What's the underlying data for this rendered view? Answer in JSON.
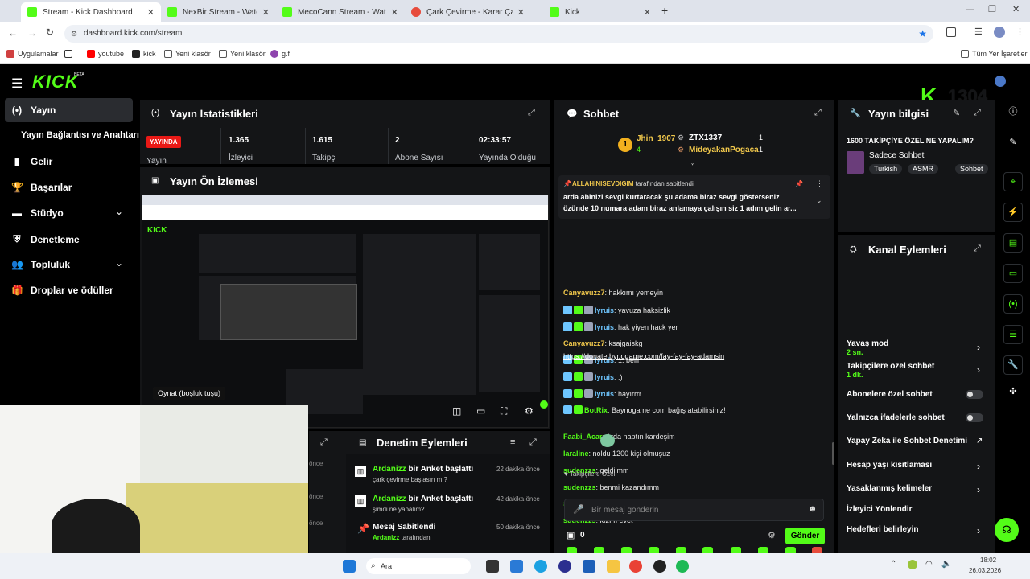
{
  "browser": {
    "tabs": [
      {
        "title": "Stream - Kick Dashboard",
        "active": true,
        "color": "#53fc18"
      },
      {
        "title": "NexBir Stream - Watch Live on",
        "active": false,
        "color": "#53fc18"
      },
      {
        "title": "MecoCann Stream - Watch Live",
        "active": false,
        "color": "#53fc18"
      },
      {
        "title": "Çark Çevirme - Karar Çarkı",
        "active": false,
        "color": "#e74c3c"
      },
      {
        "title": "Kick",
        "active": false,
        "color": "#53fc18"
      }
    ],
    "url": "dashboard.kick.com/stream",
    "bookmarks": [
      {
        "label": "Uygulamalar"
      },
      {
        "label": "youtube"
      },
      {
        "label": "kick"
      },
      {
        "label": "Yeni klasör"
      },
      {
        "label": "Yeni klasör"
      },
      {
        "label": "g.f"
      }
    ],
    "all_bookmarks": "Tüm Yer İşaretleri"
  },
  "kick": {
    "logo": "KICK",
    "logo_tag": "BETA",
    "overlay_count": "1304"
  },
  "sidebar": {
    "items": [
      {
        "label": "Yayın",
        "icon": "broadcast-icon",
        "active": true
      },
      {
        "label": "Yayın Bağlantısı ve Anahtarı",
        "icon": "",
        "active": false
      },
      {
        "label": "Gelir",
        "icon": "chart-icon",
        "active": false
      },
      {
        "label": "Başarılar",
        "icon": "trophy-icon",
        "active": false
      },
      {
        "label": "Stüdyo",
        "icon": "studio-icon",
        "active": false,
        "chevron": true
      },
      {
        "label": "Denetleme",
        "icon": "shield-icon",
        "active": false
      },
      {
        "label": "Topluluk",
        "icon": "users-icon",
        "active": false,
        "chevron": true
      },
      {
        "label": "Droplar ve ödüller",
        "icon": "gift-icon",
        "active": false
      }
    ]
  },
  "stats": {
    "title": "Yayın İstatistikleri",
    "live_badge": "YAYINDA",
    "live_label": "Yayın",
    "items": [
      {
        "value": "1.365",
        "label": "İzleyici"
      },
      {
        "value": "1.615",
        "label": "Takipçi"
      },
      {
        "value": "2",
        "label": "Abone Sayısı"
      },
      {
        "value": "02:33:57",
        "label": "Yayında Olduğu"
      }
    ]
  },
  "preview": {
    "title": "Yayın Ön İzlemesi",
    "tooltip": "Oynat (boşluk tuşu)"
  },
  "modlog": {
    "title": "Denetim Eylemleri",
    "left_times": [
      "önce",
      "önce",
      "önce"
    ],
    "entries": [
      {
        "user": "Ardanizz",
        "action": " bir Anket başlattı",
        "detail": "çark çevirme başlasın mı?",
        "time": "22 dakika önce"
      },
      {
        "user": "Ardanizz",
        "action": " bir Anket başlattı",
        "detail": "şimdi ne yapalım?",
        "time": "42 dakika önce"
      },
      {
        "user": "Mesaj Sabitlendi",
        "action": "",
        "detail_user": "Ardanizz",
        "detail": " tarafından",
        "time": "50 dakika önce"
      }
    ]
  },
  "chat": {
    "title": "Sohbet",
    "top_gifters": [
      {
        "rank": "1",
        "name": "Jhin_1907",
        "count": "4"
      },
      {
        "rank": "",
        "name": "ZTX1337",
        "count": "1"
      },
      {
        "rank": "",
        "name": "MideyakanPogaca",
        "count": "1"
      }
    ],
    "pinned_by": "ALLAHINISEVDIGIM",
    "pinned_suffix": " tarafından sabitlendi",
    "pinned_text_1": "arda abinizi sevgi kurtaracak şu adama biraz sevgi gösterseniz",
    "pinned_text_2": "özünde 10 numara adam biraz anlamaya çalışın siz 1 adım gelin ar...",
    "messages": [
      {
        "user": "Canyavuzz7",
        "color": "y",
        "badges": 0,
        "text": ": hakkımı yemeyin"
      },
      {
        "user": "lyruis",
        "color": "b",
        "badges": 3,
        "text": ": yavuza haksizlik"
      },
      {
        "user": "lyruis",
        "color": "b",
        "badges": 3,
        "text": ": hak yiyen hack yer"
      },
      {
        "user": "Canyavuzz7",
        "color": "y",
        "badges": 0,
        "text": ": ksajgaiskg"
      },
      {
        "user": "lyruis",
        "color": "b",
        "badges": 3,
        "text": ": 1. belli"
      },
      {
        "user": "lyruis",
        "color": "b",
        "badges": 3,
        "text": ": :)"
      },
      {
        "user": "lyruis",
        "color": "b",
        "badges": 3,
        "text": ": hayırrrr"
      },
      {
        "user": "BotRix",
        "color": "g",
        "badges": 2,
        "text": ": Baynogame com bağış atabilirsiniz!"
      },
      {
        "user": "Faabi_Acar",
        "color": "g",
        "badges": 0,
        "text": ": Arda naptın kardeşim"
      },
      {
        "user": "laraline",
        "color": "g",
        "badges": 0,
        "text": ": noldu 1200 kişi olmuşuz"
      },
      {
        "user": "sudenzzs",
        "color": "g",
        "badges": 0,
        "text": ": geldiimm"
      },
      {
        "user": "sudenzzs",
        "color": "g",
        "badges": 0,
        "text": ": benmi kazandımm"
      },
      {
        "user": "sudenzzs",
        "color": "g",
        "badges": 0,
        "text": ":"
      },
      {
        "user": "sudenzzs",
        "color": "g",
        "badges": 0,
        "text": ": kızım evet"
      }
    ],
    "donate_link": "https://donate.bynogame.com/fay-fay-fay-adamsin",
    "followers_only": "Takipçilere Özel",
    "input_placeholder": "Bir mesaj gönderin",
    "points": "0",
    "send_label": "Gönder"
  },
  "stream_info": {
    "title": "Yayın bilgisi",
    "stream_title": "1600 TAKİPÇİYE ÖZEL NE YAPALIM?",
    "category": "Sadece Sohbet",
    "tags": [
      "Turkish",
      "ASMR",
      "Sohbet"
    ]
  },
  "channel_actions": {
    "title": "Kanal Eylemleri",
    "items": [
      {
        "label": "Yavaş mod",
        "sub": "2 sn.",
        "type": "chevron"
      },
      {
        "label": "Takipçilere özel sohbet",
        "sub": "1 dk.",
        "type": "chevron"
      },
      {
        "label": "Abonelere özel sohbet",
        "sub": "",
        "type": "toggle"
      },
      {
        "label": "Yalnızca ifadelerle sohbet",
        "sub": "",
        "type": "toggle"
      },
      {
        "label": "Yapay Zeka ile Sohbet Denetimi",
        "sub": "",
        "type": "external"
      },
      {
        "label": "Hesap yaşı kısıtlaması",
        "sub": "",
        "type": "chevron"
      },
      {
        "label": "Yasaklanmış kelimeler",
        "sub": "",
        "type": "chevron"
      },
      {
        "label": "İzleyici Yönlendir",
        "sub": "",
        "type": "none"
      },
      {
        "label": "Hedefleri belirleyin",
        "sub": "",
        "type": "chevron"
      }
    ]
  },
  "taskbar": {
    "search": "Ara",
    "time": "18:02",
    "date": "26.03.2026"
  },
  "colors": {
    "kick_green": "#53fc18",
    "panel_bg": "#141517",
    "live_red": "#e91916"
  }
}
